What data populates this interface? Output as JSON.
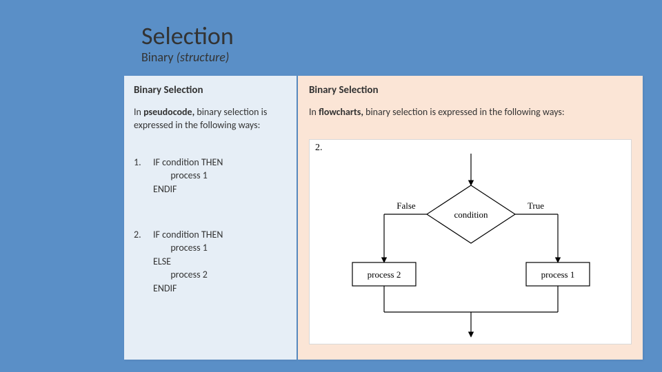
{
  "header": {
    "title": "Selection",
    "subtitle_plain": "Binary ",
    "subtitle_em": "(structure)"
  },
  "left": {
    "heading": "Binary Selection",
    "para_pre": "In ",
    "para_strong": "pseudocode,",
    "para_post": " binary selection is expressed in the following ways:",
    "items": [
      {
        "num": "1.",
        "code": "IF condition THEN\n        process 1\nENDIF"
      },
      {
        "num": "2.",
        "code": "IF condition THEN\n        process 1\nELSE\n        process 2\nENDIF"
      }
    ]
  },
  "right": {
    "heading": "Binary Selection",
    "para_pre": "In ",
    "para_strong": "flowcharts,",
    "para_post": " binary selection is expressed in the following ways:",
    "diagram_num": "2.",
    "labels": {
      "condition": "condition",
      "true": "True",
      "false": "False",
      "process1": "process 1",
      "process2": "process 2"
    }
  }
}
